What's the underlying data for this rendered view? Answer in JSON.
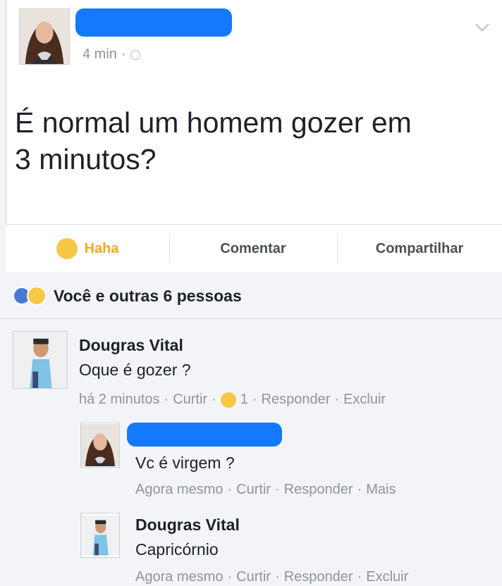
{
  "post": {
    "time": "4 min",
    "separator": "·",
    "text_line1": "É normal um homem gozer em",
    "text_line2": "3 minutos?"
  },
  "actions": {
    "haha_label": "Haha",
    "comment_label": "Comentar",
    "share_label": "Compartilhar"
  },
  "reactions": {
    "summary": "Você e outras 6 pessoas"
  },
  "comments": [
    {
      "author": "Dougras Vital",
      "text": "Oque é gozer ?",
      "meta_time": "há 2 minutos",
      "meta_like": "Curtir",
      "meta_reaction_count": "1",
      "meta_reply": "Responder",
      "meta_extra": "Excluir"
    },
    {
      "author_redacted": true,
      "text": "Vc é virgem ?",
      "meta_time": "Agora mesmo",
      "meta_like": "Curtir",
      "meta_reply": "Responder",
      "meta_extra": "Mais"
    },
    {
      "author": "Dougras Vital",
      "text": "Capricórnio",
      "meta_time": "Agora mesmo",
      "meta_like": "Curtir",
      "meta_reply": "Responder",
      "meta_extra": "Excluir"
    }
  ],
  "colors": {
    "redaction": "#1479ff",
    "haha": "#f5a623",
    "like": "#4a78d6"
  }
}
